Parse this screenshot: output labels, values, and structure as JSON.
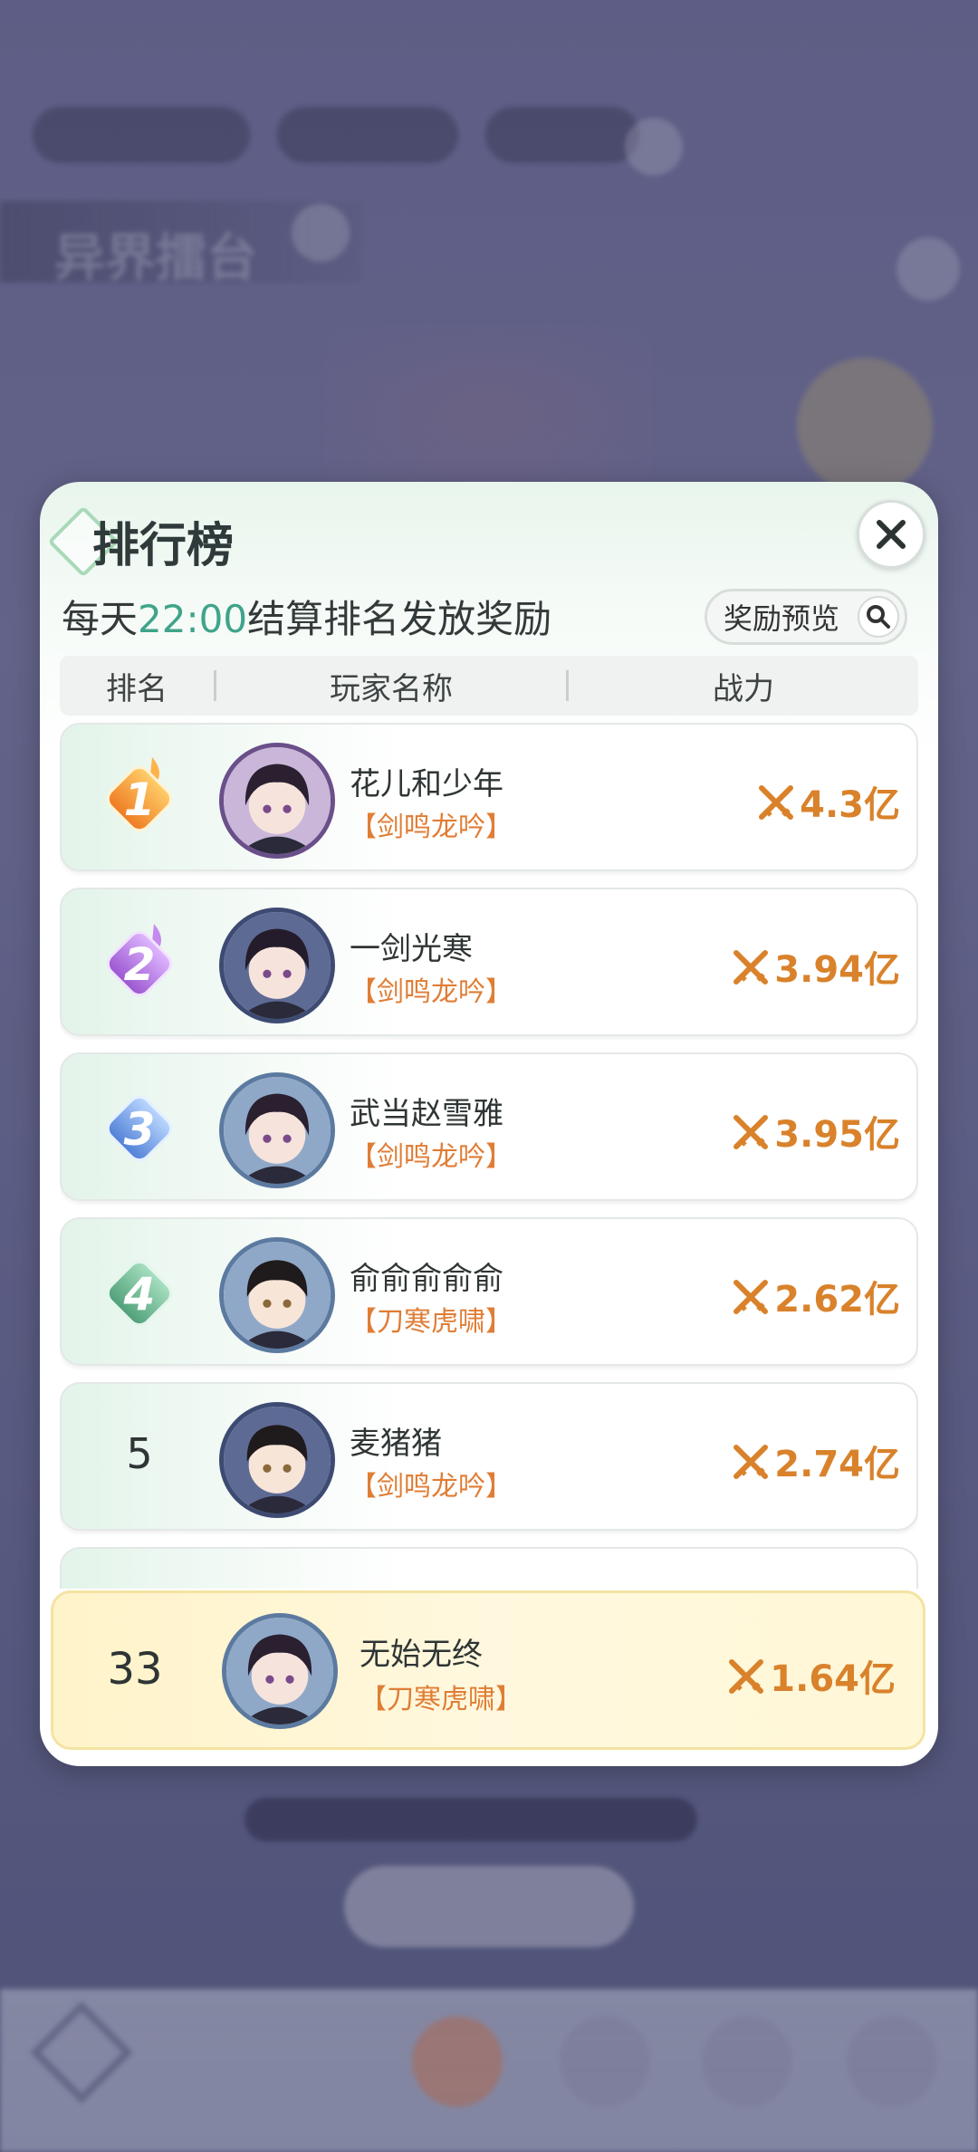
{
  "leaderboard": {
    "title": "排行榜",
    "notice_prefix": "每天",
    "notice_time": "22:00",
    "notice_suffix": "结算排名发放奖励",
    "reward_preview_label": "奖励预览",
    "columns": {
      "rank": "排名",
      "player_name": "玩家名称",
      "power": "战力"
    },
    "rows": [
      {
        "rank": "1",
        "name": "花儿和少年",
        "class": "【剑鸣龙吟】",
        "power": "4.3亿"
      },
      {
        "rank": "2",
        "name": "一剑光寒",
        "class": "【剑鸣龙吟】",
        "power": "3.94亿"
      },
      {
        "rank": "3",
        "name": "武当赵雪雅",
        "class": "【剑鸣龙吟】",
        "power": "3.95亿"
      },
      {
        "rank": "4",
        "name": "俞俞俞俞俞",
        "class": "【刀寒虎啸】",
        "power": "2.62亿"
      },
      {
        "rank": "5",
        "name": "麦猪猪",
        "class": "【剑鸣龙吟】",
        "power": "2.74亿"
      }
    ],
    "self": {
      "rank": "33",
      "name": "无始无终",
      "class": "【刀寒虎啸】",
      "power": "1.64亿"
    }
  },
  "colors": {
    "accent_green": "#3fa48a",
    "power_orange": "#d9822b",
    "class_orange": "#e07d35",
    "rank1": "#f29a3a",
    "rank2": "#a76ad6",
    "rank3": "#5b8fe0",
    "rank4": "#5fb489"
  },
  "icons": {
    "close": "close-icon",
    "search": "search-icon",
    "power": "crossed-swords-icon"
  }
}
